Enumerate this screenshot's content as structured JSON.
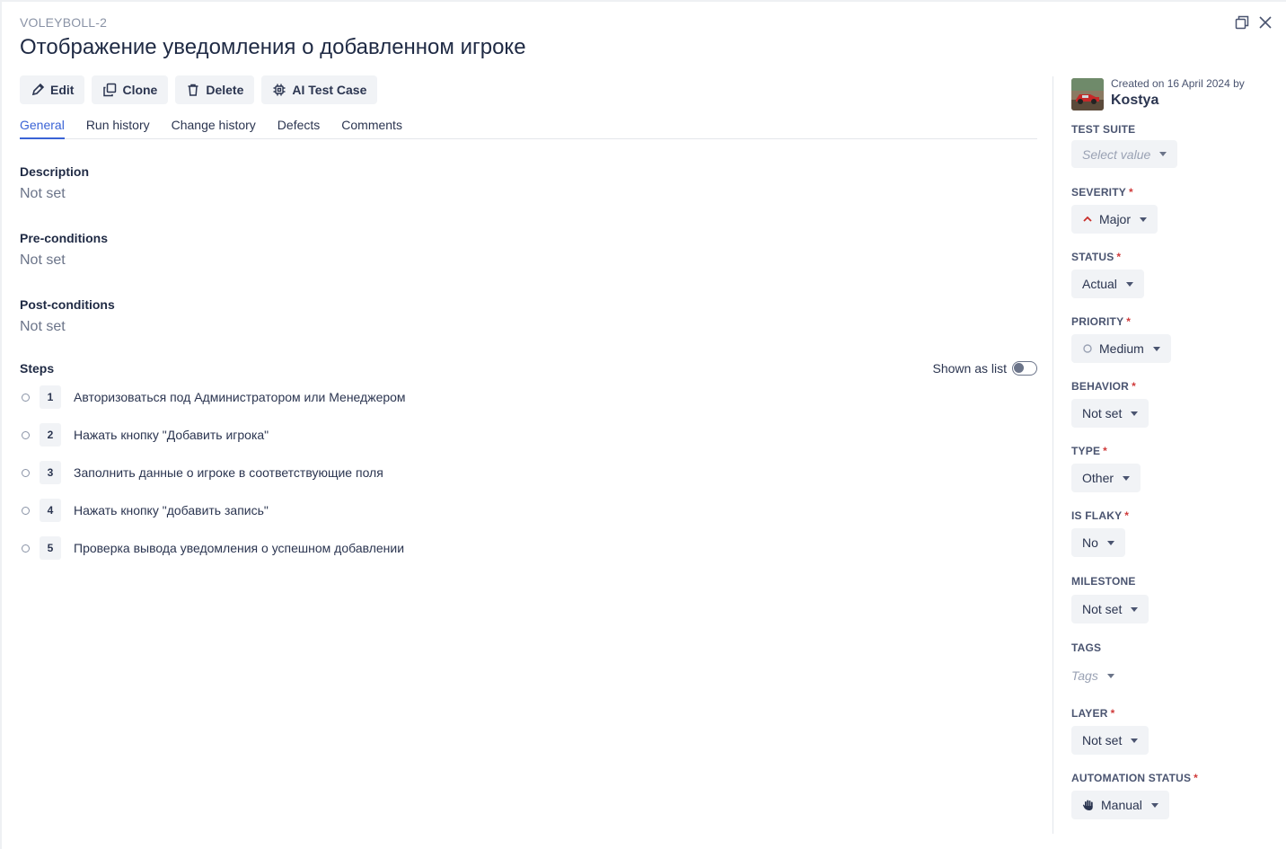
{
  "header": {
    "case_key": "VOLEYBOLL-2",
    "title": "Отображение уведомления о добавленном игроке"
  },
  "window_controls": [
    "restore-icon",
    "close-icon"
  ],
  "toolbar": {
    "edit": "Edit",
    "clone": "Clone",
    "delete": "Delete",
    "ai_test_case": "AI Test Case"
  },
  "tabs": [
    "General",
    "Run history",
    "Change history",
    "Defects",
    "Comments"
  ],
  "active_tab": "General",
  "general": {
    "description": {
      "label": "Description",
      "value": "Not set"
    },
    "preconditions": {
      "label": "Pre-conditions",
      "value": "Not set"
    },
    "postconditions": {
      "label": "Post-conditions",
      "value": "Not set"
    },
    "steps_label": "Steps",
    "shown_as_list": "Shown as list",
    "steps": [
      {
        "num": "1",
        "text": "Авторизоваться под Администратором или Менеджером"
      },
      {
        "num": "2",
        "text": "Нажать кнопку \"Добавить игрока\""
      },
      {
        "num": "3",
        "text": "Заполнить данные о игроке в соответствующие поля"
      },
      {
        "num": "4",
        "text": "Нажать кнопку \"добавить запись\""
      },
      {
        "num": "5",
        "text": "Проверка вывода уведомления о успешном добавлении"
      }
    ]
  },
  "sidebar": {
    "created": "Created on 16 April 2024 by",
    "author": "Kostya",
    "fields": {
      "test_suite": {
        "label": "TEST SUITE",
        "value": "Select value",
        "required": false
      },
      "severity": {
        "label": "SEVERITY",
        "value": "Major",
        "required": true
      },
      "status": {
        "label": "STATUS",
        "value": "Actual",
        "required": true
      },
      "priority": {
        "label": "PRIORITY",
        "value": "Medium",
        "required": true
      },
      "behavior": {
        "label": "BEHAVIOR",
        "value": "Not set",
        "required": true
      },
      "type": {
        "label": "TYPE",
        "value": "Other",
        "required": true
      },
      "is_flaky": {
        "label": "IS FLAKY",
        "value": "No",
        "required": true
      },
      "milestone": {
        "label": "MILESTONE",
        "value": "Not set",
        "required": false
      },
      "tags": {
        "label": "TAGS",
        "value": "Tags",
        "required": false
      },
      "layer": {
        "label": "LAYER",
        "value": "Not set",
        "required": true
      },
      "automation_status": {
        "label": "AUTOMATION STATUS",
        "value": "Manual",
        "required": true
      }
    },
    "required_mark": "*"
  },
  "colors": {
    "accent": "#3a63d6",
    "required": "#d03b3b",
    "severity_major": "#c9302c",
    "text": "#1f2a44",
    "muted": "#6b7489"
  }
}
